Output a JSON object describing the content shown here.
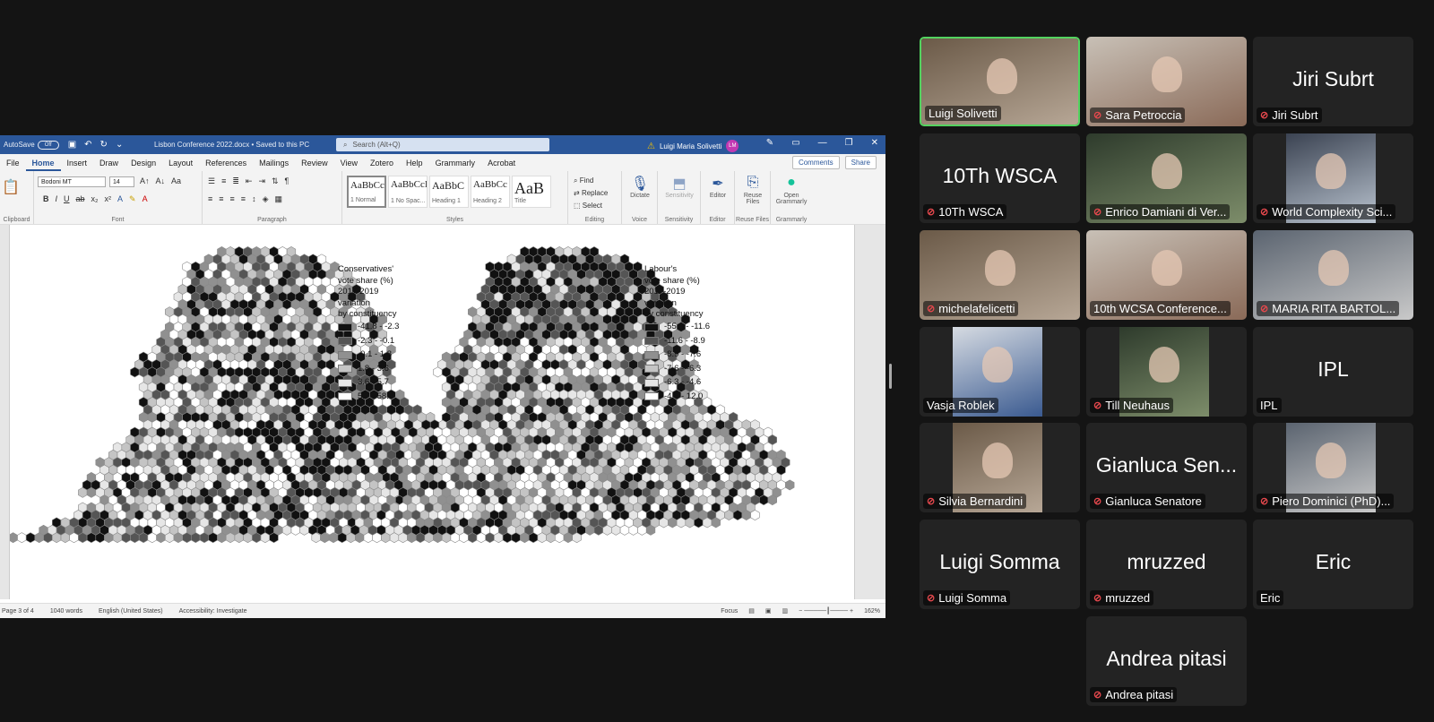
{
  "word": {
    "autosave_label": "AutoSave",
    "autosave_state": "Off",
    "doc_title": "Lisbon Conference 2022.docx • Saved to this PC",
    "search_placeholder": "Search (Alt+Q)",
    "user_name": "Luigi Maria Solivetti",
    "user_initials": "LM",
    "tabs": [
      "File",
      "Home",
      "Insert",
      "Draw",
      "Design",
      "Layout",
      "References",
      "Mailings",
      "Review",
      "View",
      "Zotero",
      "Help",
      "Grammarly",
      "Acrobat"
    ],
    "comments_label": "Comments",
    "share_label": "Share",
    "font_name": "Bodoni MT",
    "font_size": "14",
    "styles": [
      {
        "sample": "AaBbCcI",
        "name": "1 Normal"
      },
      {
        "sample": "AaBbCcI",
        "name": "1 No Spac..."
      },
      {
        "sample": "AaBbC",
        "name": "Heading 1"
      },
      {
        "sample": "AaBbCc",
        "name": "Heading 2"
      },
      {
        "sample": "AaB",
        "name": "Title"
      }
    ],
    "editing": {
      "find": "Find",
      "replace": "Replace",
      "select": "Select"
    },
    "buttons": {
      "dictate": "Dictate",
      "sensitivity": "Sensitivity",
      "editor": "Editor",
      "reuse": "Reuse Files",
      "grammarly": "Open Grammarly"
    },
    "groups": {
      "clipboard": "Clipboard",
      "font": "Font",
      "paragraph": "Paragraph",
      "styles": "Styles",
      "editing": "Editing",
      "voice": "Voice",
      "sensitivity": "Sensitivity",
      "editor": "Editor",
      "reuse": "Reuse Files",
      "grammarly": "Grammarly"
    },
    "status": {
      "page": "Page 3 of 4",
      "words": "1040 words",
      "language": "English (United States)",
      "accessibility": "Accessibility: Investigate",
      "focus": "Focus",
      "zoom": "162%"
    }
  },
  "maps": [
    {
      "legend_title": [
        "Conservatives'",
        "vote share (%)",
        "2017-2019",
        "variation",
        "by constituency"
      ],
      "legend_items": [
        "-41.8 - -2.3",
        "-2.3 - -0.1",
        "-0.1 - 1.8",
        "1.8 - 3.6",
        "3.6 - 5.7",
        "5.7 - 58.4"
      ]
    },
    {
      "legend_title": [
        "Labour's",
        "vote share (%)",
        "2017-2019",
        "variation",
        "by constituency"
      ],
      "legend_items": [
        "-55.3 - -11.6",
        "-11.6 - -8.9",
        "-8.9 - -7.6",
        "-7.6 - -6.3",
        "-6.3 - -4.6",
        "-4.6 - 12.0"
      ]
    }
  ],
  "legend_colors": [
    "#111111",
    "#555555",
    "#909090",
    "#c4c4c4",
    "#e6e6e6",
    "#ffffff"
  ],
  "participants": [
    {
      "name": "Luigi Solivetti",
      "muted": false,
      "video": true,
      "active": true
    },
    {
      "name": "Sara Petroccia",
      "muted": true,
      "video": true
    },
    {
      "name": "Jiri Subrt",
      "muted": true,
      "video": false
    },
    {
      "name": "10Th WSCA",
      "muted": true,
      "video": false
    },
    {
      "name": "Enrico Damiani di Ver...",
      "muted": true,
      "video": true
    },
    {
      "name": "World Complexity Sci...",
      "muted": true,
      "video": true
    },
    {
      "name": "michelafelicetti",
      "muted": true,
      "video": true
    },
    {
      "name": "10th WCSA Conference...",
      "muted": false,
      "video": true
    },
    {
      "name": "MARIA RITA BARTOL...",
      "muted": true,
      "video": true
    },
    {
      "name": "Vasja Roblek",
      "muted": false,
      "video": true
    },
    {
      "name": "Till Neuhaus",
      "muted": true,
      "video": true
    },
    {
      "name": "IPL",
      "muted": false,
      "video": false
    },
    {
      "name": "Silvia Bernardini",
      "muted": true,
      "video": true
    },
    {
      "name": "Gianluca Senatore",
      "muted": true,
      "video": false,
      "big": "Gianluca Sen..."
    },
    {
      "name": "Piero Dominici (PhD)...",
      "muted": true,
      "video": true
    },
    {
      "name": "Luigi Somma",
      "muted": true,
      "video": false
    },
    {
      "name": "mruzzed",
      "muted": true,
      "video": false
    },
    {
      "name": "Eric",
      "muted": false,
      "video": false
    },
    {
      "name": "Andrea pitasi",
      "muted": true,
      "video": false
    }
  ]
}
